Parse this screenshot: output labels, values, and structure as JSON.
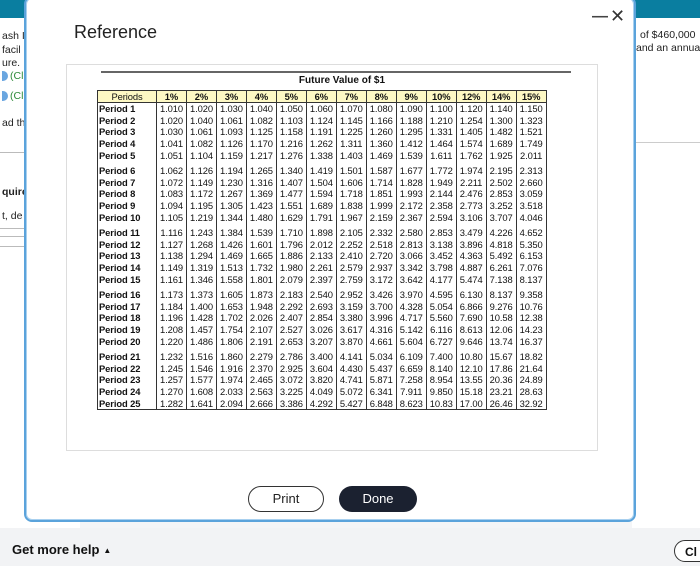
{
  "background": {
    "left_lines": [
      "ash I",
      " facil",
      "ure.",
      "(Cli",
      "(Cli",
      "ad th",
      "quire",
      "t, de"
    ],
    "right_lines": [
      "of $460,000",
      "and an annua"
    ],
    "get_help": "Get more help",
    "close_partial": "Cl"
  },
  "modal": {
    "title": "Reference",
    "minimize_icon": "—",
    "close_icon": "✕",
    "print_label": "Print",
    "done_label": "Done"
  },
  "table": {
    "title": "Future Value of $1",
    "header_first": "Periods",
    "rates": [
      "1%",
      "2%",
      "3%",
      "4%",
      "5%",
      "6%",
      "7%",
      "8%",
      "9%",
      "10%",
      "12%",
      "14%",
      "15%"
    ],
    "rows": [
      {
        "period": "Period 1",
        "values": [
          "1.010",
          "1.020",
          "1.030",
          "1.040",
          "1.050",
          "1.060",
          "1.070",
          "1.080",
          "1.090",
          "1.100",
          "1.120",
          "1.140",
          "1.150"
        ]
      },
      {
        "period": "Period 2",
        "values": [
          "1.020",
          "1.040",
          "1.061",
          "1.082",
          "1.103",
          "1.124",
          "1.145",
          "1.166",
          "1.188",
          "1.210",
          "1.254",
          "1.300",
          "1.323"
        ]
      },
      {
        "period": "Period 3",
        "values": [
          "1.030",
          "1.061",
          "1.093",
          "1.125",
          "1.158",
          "1.191",
          "1.225",
          "1.260",
          "1.295",
          "1.331",
          "1.405",
          "1.482",
          "1.521"
        ]
      },
      {
        "period": "Period 4",
        "values": [
          "1.041",
          "1.082",
          "1.126",
          "1.170",
          "1.216",
          "1.262",
          "1.311",
          "1.360",
          "1.412",
          "1.464",
          "1.574",
          "1.689",
          "1.749"
        ]
      },
      {
        "period": "Period 5",
        "values": [
          "1.051",
          "1.104",
          "1.159",
          "1.217",
          "1.276",
          "1.338",
          "1.403",
          "1.469",
          "1.539",
          "1.611",
          "1.762",
          "1.925",
          "2.011"
        ]
      },
      {
        "period": "Period 6",
        "values": [
          "1.062",
          "1.126",
          "1.194",
          "1.265",
          "1.340",
          "1.419",
          "1.501",
          "1.587",
          "1.677",
          "1.772",
          "1.974",
          "2.195",
          "2.313"
        ]
      },
      {
        "period": "Period 7",
        "values": [
          "1.072",
          "1.149",
          "1.230",
          "1.316",
          "1.407",
          "1.504",
          "1.606",
          "1.714",
          "1.828",
          "1.949",
          "2.211",
          "2.502",
          "2.660"
        ]
      },
      {
        "period": "Period 8",
        "values": [
          "1.083",
          "1.172",
          "1.267",
          "1.369",
          "1.477",
          "1.594",
          "1.718",
          "1.851",
          "1.993",
          "2.144",
          "2.476",
          "2.853",
          "3.059"
        ]
      },
      {
        "period": "Period 9",
        "values": [
          "1.094",
          "1.195",
          "1.305",
          "1.423",
          "1.551",
          "1.689",
          "1.838",
          "1.999",
          "2.172",
          "2.358",
          "2.773",
          "3.252",
          "3.518"
        ]
      },
      {
        "period": "Period 10",
        "values": [
          "1.105",
          "1.219",
          "1.344",
          "1.480",
          "1.629",
          "1.791",
          "1.967",
          "2.159",
          "2.367",
          "2.594",
          "3.106",
          "3.707",
          "4.046"
        ]
      },
      {
        "period": "Period 11",
        "values": [
          "1.116",
          "1.243",
          "1.384",
          "1.539",
          "1.710",
          "1.898",
          "2.105",
          "2.332",
          "2.580",
          "2.853",
          "3.479",
          "4.226",
          "4.652"
        ]
      },
      {
        "period": "Period 12",
        "values": [
          "1.127",
          "1.268",
          "1.426",
          "1.601",
          "1.796",
          "2.012",
          "2.252",
          "2.518",
          "2.813",
          "3.138",
          "3.896",
          "4.818",
          "5.350"
        ]
      },
      {
        "period": "Period 13",
        "values": [
          "1.138",
          "1.294",
          "1.469",
          "1.665",
          "1.886",
          "2.133",
          "2.410",
          "2.720",
          "3.066",
          "3.452",
          "4.363",
          "5.492",
          "6.153"
        ]
      },
      {
        "period": "Period 14",
        "values": [
          "1.149",
          "1.319",
          "1.513",
          "1.732",
          "1.980",
          "2.261",
          "2.579",
          "2.937",
          "3.342",
          "3.798",
          "4.887",
          "6.261",
          "7.076"
        ]
      },
      {
        "period": "Period 15",
        "values": [
          "1.161",
          "1.346",
          "1.558",
          "1.801",
          "2.079",
          "2.397",
          "2.759",
          "3.172",
          "3.642",
          "4.177",
          "5.474",
          "7.138",
          "8.137"
        ]
      },
      {
        "period": "Period 16",
        "values": [
          "1.173",
          "1.373",
          "1.605",
          "1.873",
          "2.183",
          "2.540",
          "2.952",
          "3.426",
          "3.970",
          "4.595",
          "6.130",
          "8.137",
          "9.358"
        ]
      },
      {
        "period": "Period 17",
        "values": [
          "1.184",
          "1.400",
          "1.653",
          "1.948",
          "2.292",
          "2.693",
          "3.159",
          "3.700",
          "4.328",
          "5.054",
          "6.866",
          "9.276",
          "10.76"
        ]
      },
      {
        "period": "Period 18",
        "values": [
          "1.196",
          "1.428",
          "1.702",
          "2.026",
          "2.407",
          "2.854",
          "3.380",
          "3.996",
          "4.717",
          "5.560",
          "7.690",
          "10.58",
          "12.38"
        ]
      },
      {
        "period": "Period 19",
        "values": [
          "1.208",
          "1.457",
          "1.754",
          "2.107",
          "2.527",
          "3.026",
          "3.617",
          "4.316",
          "5.142",
          "6.116",
          "8.613",
          "12.06",
          "14.23"
        ]
      },
      {
        "period": "Period 20",
        "values": [
          "1.220",
          "1.486",
          "1.806",
          "2.191",
          "2.653",
          "3.207",
          "3.870",
          "4.661",
          "5.604",
          "6.727",
          "9.646",
          "13.74",
          "16.37"
        ]
      },
      {
        "period": "Period 21",
        "values": [
          "1.232",
          "1.516",
          "1.860",
          "2.279",
          "2.786",
          "3.400",
          "4.141",
          "5.034",
          "6.109",
          "7.400",
          "10.80",
          "15.67",
          "18.82"
        ]
      },
      {
        "period": "Period 22",
        "values": [
          "1.245",
          "1.546",
          "1.916",
          "2.370",
          "2.925",
          "3.604",
          "4.430",
          "5.437",
          "6.659",
          "8.140",
          "12.10",
          "17.86",
          "21.64"
        ]
      },
      {
        "period": "Period 23",
        "values": [
          "1.257",
          "1.577",
          "1.974",
          "2.465",
          "3.072",
          "3.820",
          "4.741",
          "5.871",
          "7.258",
          "8.954",
          "13.55",
          "20.36",
          "24.89"
        ]
      },
      {
        "period": "Period 24",
        "values": [
          "1.270",
          "1.608",
          "2.033",
          "2.563",
          "3.225",
          "4.049",
          "5.072",
          "6.341",
          "7.911",
          "9.850",
          "15.18",
          "23.21",
          "28.63"
        ]
      },
      {
        "period": "Period 25",
        "values": [
          "1.282",
          "1.641",
          "2.094",
          "2.666",
          "3.386",
          "4.292",
          "5.427",
          "6.848",
          "8.623",
          "10.83",
          "17.00",
          "26.46",
          "32.92"
        ]
      }
    ]
  },
  "colors": {
    "header_bg": "#fdf8c4",
    "modal_border": "#5ba3db",
    "done_bg": "#1b2130",
    "topbar": "#0a7ea0"
  }
}
